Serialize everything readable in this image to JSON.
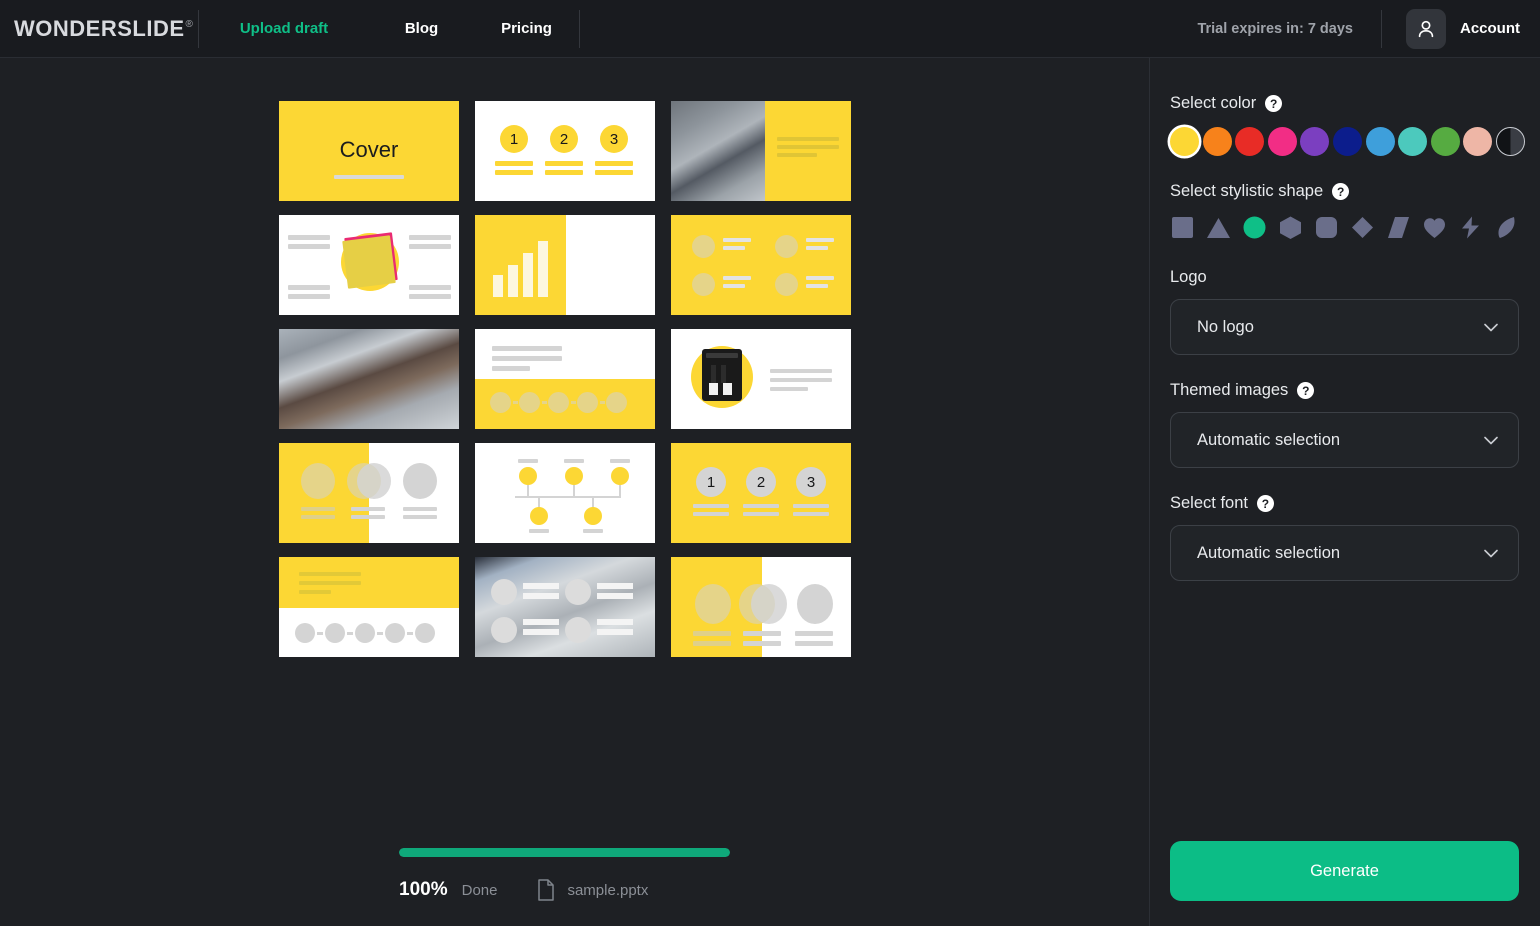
{
  "header": {
    "brand": "WONDERSLIDE",
    "brand_mark": "®",
    "nav": [
      {
        "label": "Upload draft",
        "active": true
      },
      {
        "label": "Blog",
        "active": false
      },
      {
        "label": "Pricing",
        "active": false
      }
    ],
    "trial": "Trial expires in: 7 days",
    "account": "Account",
    "avatar_icon": "user-icon"
  },
  "main": {
    "progress": {
      "percent_label": "100%",
      "percent_value": 100,
      "status": "Done",
      "filename": "sample.pptx",
      "file_icon": "document-icon",
      "bar_color": "#0fa87a"
    },
    "slides": [
      {
        "index": 1,
        "name": "cover-slide",
        "title": "Cover"
      },
      {
        "index": 2,
        "name": "numbered-list-slide",
        "numbers": [
          "1",
          "2",
          "3"
        ]
      },
      {
        "index": 3,
        "name": "photo-right-text-slide"
      },
      {
        "index": 4,
        "name": "center-image-two-column-slide"
      },
      {
        "index": 5,
        "name": "bar-chart-slide"
      },
      {
        "index": 6,
        "name": "four-icon-grid-slide"
      },
      {
        "index": 7,
        "name": "full-photo-slide"
      },
      {
        "index": 8,
        "name": "timeline-dots-slide"
      },
      {
        "index": 9,
        "name": "product-image-slide"
      },
      {
        "index": 10,
        "name": "three-avatar-slide"
      },
      {
        "index": 11,
        "name": "org-tree-slide"
      },
      {
        "index": 12,
        "name": "numbered-cards-slide",
        "numbers": [
          "1",
          "2",
          "3"
        ]
      },
      {
        "index": 13,
        "name": "header-timeline-slide"
      },
      {
        "index": 14,
        "name": "photo-overlay-list-slide"
      },
      {
        "index": 15,
        "name": "three-avatar-split-slide"
      }
    ]
  },
  "sidebar": {
    "color_section": {
      "label": "Select color",
      "help_icon": "help-icon",
      "selected_index": 0,
      "swatches": [
        {
          "name": "yellow",
          "hex": "#fcd734"
        },
        {
          "name": "orange",
          "hex": "#f7821b"
        },
        {
          "name": "red",
          "hex": "#e82c26"
        },
        {
          "name": "pink",
          "hex": "#f22d85"
        },
        {
          "name": "purple",
          "hex": "#7b3fc0"
        },
        {
          "name": "navy",
          "hex": "#0c1d8c"
        },
        {
          "name": "blue",
          "hex": "#3e9fdb"
        },
        {
          "name": "teal",
          "hex": "#4cc9bd"
        },
        {
          "name": "green",
          "hex": "#56ab41"
        },
        {
          "name": "blush",
          "hex": "#eeb6a6"
        },
        {
          "name": "custom",
          "hex": "#111316"
        }
      ]
    },
    "shape_section": {
      "label": "Select stylistic shape",
      "help_icon": "help-icon",
      "selected_index": 2,
      "shapes": [
        {
          "name": "square"
        },
        {
          "name": "triangle"
        },
        {
          "name": "circle"
        },
        {
          "name": "hexagon"
        },
        {
          "name": "rounded-square"
        },
        {
          "name": "diamond"
        },
        {
          "name": "parallelogram"
        },
        {
          "name": "heart"
        },
        {
          "name": "lightning-bolt"
        },
        {
          "name": "leaf"
        }
      ]
    },
    "logo": {
      "label": "Logo",
      "value": "No logo",
      "chevron_icon": "chevron-down-icon"
    },
    "themed_images": {
      "label": "Themed images",
      "help_icon": "help-icon",
      "value": "Automatic selection",
      "chevron_icon": "chevron-down-icon"
    },
    "font": {
      "label": "Select font",
      "help_icon": "help-icon",
      "value": "Automatic selection",
      "chevron_icon": "chevron-down-icon"
    },
    "generate_label": "Generate",
    "accent_color": "#0cbd86"
  }
}
